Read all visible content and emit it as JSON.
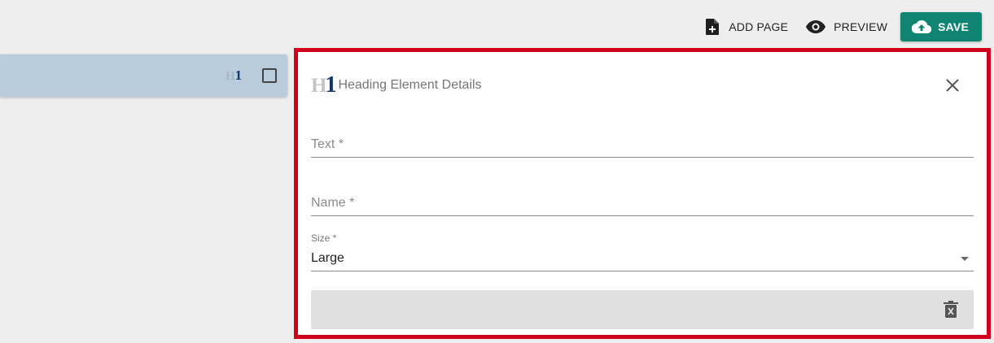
{
  "toolbar": {
    "add_page_label": "ADD PAGE",
    "preview_label": "PREVIEW",
    "save_label": "SAVE",
    "save_color": "#0f8473"
  },
  "element_card": {
    "icon": "heading-h1-icon",
    "icon_h": "H",
    "icon_1": "1",
    "background": "#b8ccdc"
  },
  "panel": {
    "icon_h": "H",
    "icon_1": "1",
    "title": "Heading Element Details",
    "highlight_color": "#d0021b",
    "fields": {
      "text_label": "Text *",
      "name_label": "Name *",
      "size_label": "Size *",
      "size_value": "Large"
    }
  }
}
